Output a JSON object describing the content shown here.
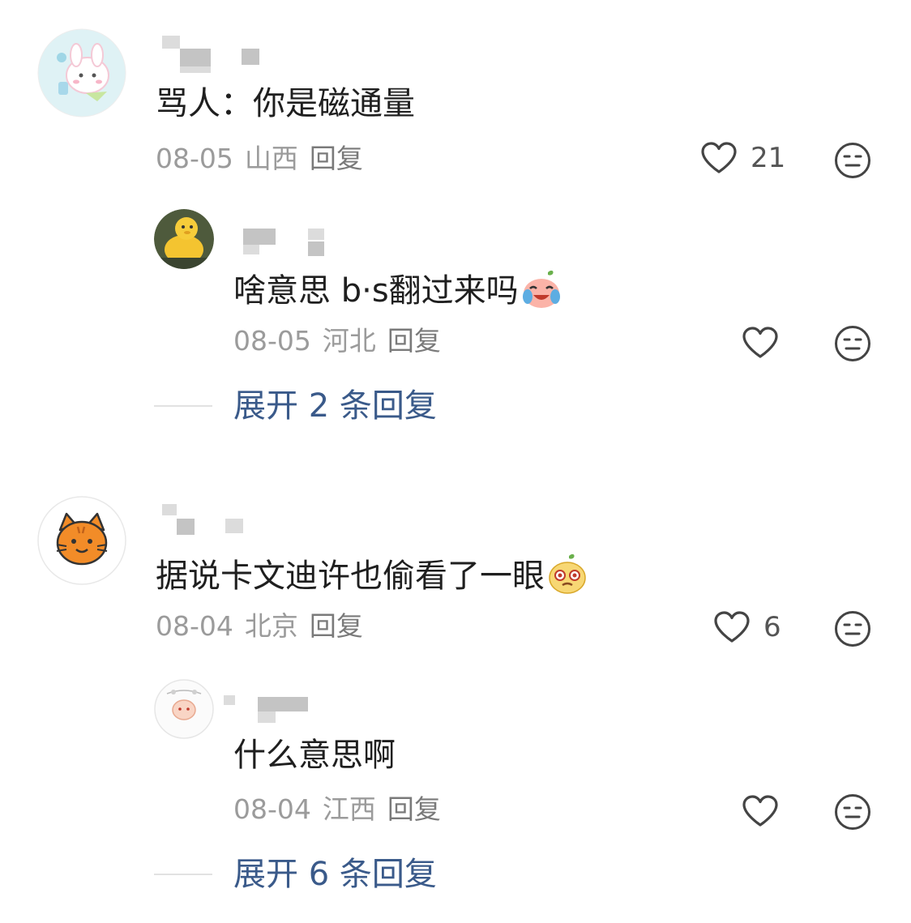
{
  "comments": [
    {
      "text": "骂人：你是磁通量",
      "date": "08-05",
      "location": "山西",
      "reply_label": "回复",
      "like_count": "21",
      "sub_reply": {
        "text": "啥意思 b·s翻过来吗",
        "emoji": "laughing-crying-peach-emoji",
        "date": "08-05",
        "location": "河北",
        "reply_label": "回复"
      },
      "expand_label": "展开 2 条回复"
    },
    {
      "text": "据说卡文迪许也偷看了一眼",
      "emoji": "smirking-peach-emoji",
      "date": "08-04",
      "location": "北京",
      "reply_label": "回复",
      "like_count": "6",
      "sub_reply": {
        "text": "什么意思啊",
        "date": "08-04",
        "location": "江西",
        "reply_label": "回复"
      },
      "expand_label": "展开 6 条回复"
    }
  ],
  "icons": {
    "like": "heart-outline-icon",
    "dislike": "neutral-face-icon"
  },
  "colors": {
    "link": "#3a5a8a",
    "meta": "#9b9b9b",
    "text": "#1f1f1f",
    "icon_stroke": "#444444"
  }
}
